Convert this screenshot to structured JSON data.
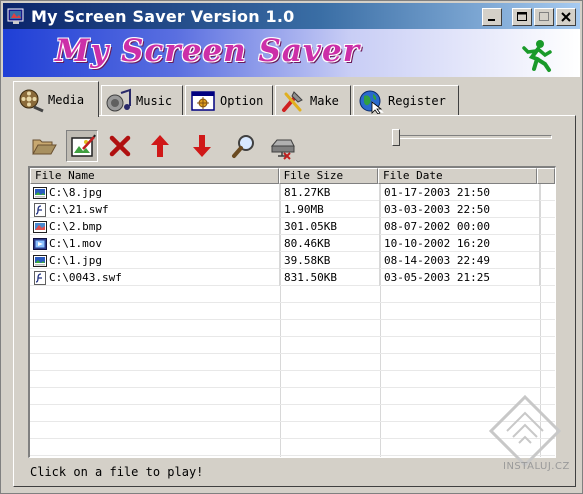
{
  "window": {
    "title": "My Screen Saver Version 1.0",
    "minimize_icon": "minimize-icon",
    "maximize_icon": "maximize-icon",
    "close_icon": "close-icon"
  },
  "banner": {
    "logo_text": "My Screen Saver",
    "mascot_icon": "running-man-icon"
  },
  "tabs": [
    {
      "label": "Media",
      "icon": "film-reel-icon",
      "active": true
    },
    {
      "label": "Music",
      "icon": "speaker-icon",
      "active": false
    },
    {
      "label": "Option",
      "icon": "options-window-icon",
      "active": false
    },
    {
      "label": "Make",
      "icon": "tools-icon",
      "active": false
    },
    {
      "label": "Register",
      "icon": "register-globe-icon",
      "active": false
    }
  ],
  "toolbar": {
    "tools": [
      {
        "name": "open-folder",
        "icon": "open-folder-icon"
      },
      {
        "name": "edit",
        "icon": "edit-picture-icon"
      },
      {
        "name": "delete",
        "icon": "delete-x-icon"
      },
      {
        "name": "move-up",
        "icon": "arrow-up-icon"
      },
      {
        "name": "move-down",
        "icon": "arrow-down-icon"
      },
      {
        "name": "preview",
        "icon": "magnifier-icon"
      },
      {
        "name": "clear-all",
        "icon": "drive-clear-icon"
      }
    ],
    "slider_value": 0
  },
  "file_list": {
    "columns": [
      "File Name",
      "File Size",
      "File Date"
    ],
    "rows": [
      {
        "icon": "image-file-icon",
        "name": "C:\\8.jpg",
        "size": "81.27KB",
        "date": "01-17-2003 21:50"
      },
      {
        "icon": "flash-file-icon",
        "name": "C:\\21.swf",
        "size": "1.90MB",
        "date": "03-03-2003 22:50"
      },
      {
        "icon": "bitmap-file-icon",
        "name": "C:\\2.bmp",
        "size": "301.05KB",
        "date": "08-07-2002 00:00"
      },
      {
        "icon": "movie-file-icon",
        "name": "C:\\1.mov",
        "size": "80.46KB",
        "date": "10-10-2002 16:20"
      },
      {
        "icon": "image-file-icon",
        "name": "C:\\1.jpg",
        "size": "39.58KB",
        "date": "08-14-2003 22:49"
      },
      {
        "icon": "flash-file-icon",
        "name": "C:\\0043.swf",
        "size": "831.50KB",
        "date": "03-05-2003 21:25"
      }
    ]
  },
  "status": "Click on a file to play!",
  "watermark": {
    "text": "INSTALUJ.CZ"
  },
  "colors": {
    "title_bar": "#0a246a",
    "banner_blue": "#1f3fd6",
    "logo_magenta": "#cc2fa8",
    "runner_green": "#1a9a2a",
    "delete_red": "#b01010",
    "arrow_red": "#d01818"
  }
}
